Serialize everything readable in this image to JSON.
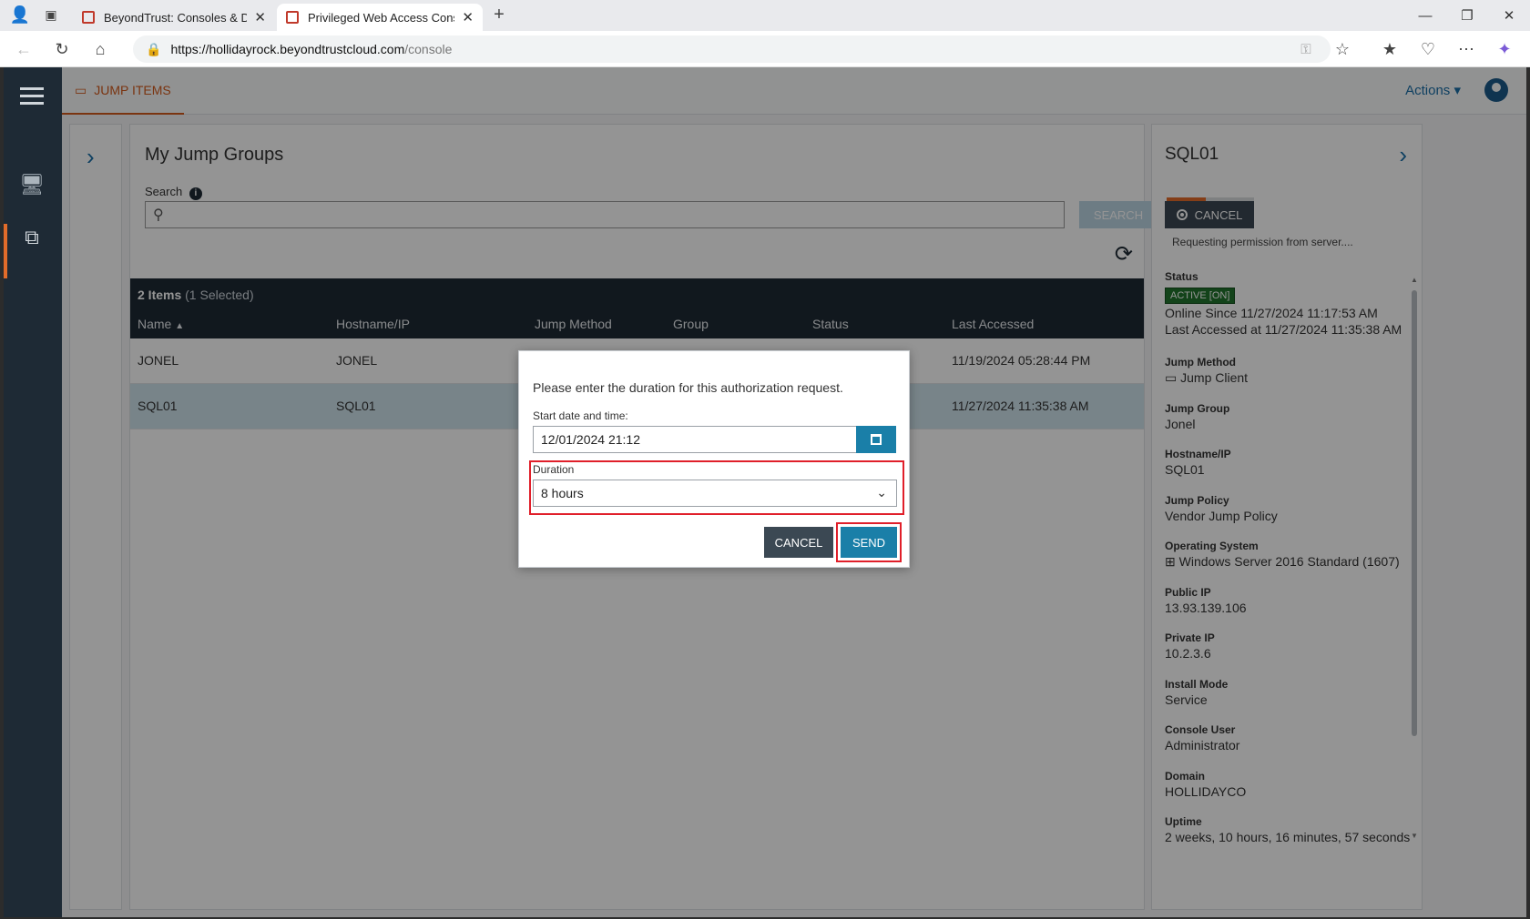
{
  "browser": {
    "tabs": [
      {
        "label": "BeyondTrust: Consoles & Downlo"
      },
      {
        "label": "Privileged Web Access Console - "
      }
    ],
    "url_host": "https://hollidayrock.beyondtrustcloud.com",
    "url_path": "/console"
  },
  "app": {
    "top_tab": "JUMP ITEMS",
    "actions_label": "Actions"
  },
  "main": {
    "title": "My Jump Groups",
    "search_label": "Search",
    "search_button": "SEARCH",
    "items_count": "2 Items",
    "selected_count": "(1 Selected)",
    "columns": [
      "Name",
      "Hostname/IP",
      "Jump Method",
      "Group",
      "Status",
      "Last Accessed"
    ],
    "rows": [
      {
        "name": "JONEL",
        "host": "JONEL",
        "last_accessed": "11/19/2024 05:28:44 PM"
      },
      {
        "name": "SQL01",
        "host": "SQL01",
        "last_accessed": "11/27/2024 11:35:38 AM"
      }
    ]
  },
  "detail": {
    "title": "SQL01",
    "cancel_label": "CANCEL",
    "requesting": "Requesting permission from server....",
    "status_label": "Status",
    "status_badge": "ACTIVE [ON]",
    "online_since": "Online Since 11/27/2024 11:17:53 AM",
    "last_accessed": "Last Accessed at 11/27/2024 11:35:38 AM",
    "fields": [
      {
        "label": "Jump Method",
        "value": "Jump Client"
      },
      {
        "label": "Jump Group",
        "value": "Jonel"
      },
      {
        "label": "Hostname/IP",
        "value": "SQL01"
      },
      {
        "label": "Jump Policy",
        "value": "Vendor Jump Policy"
      },
      {
        "label": "Operating System",
        "value": "Windows Server 2016 Standard (1607)"
      },
      {
        "label": "Public IP",
        "value": "13.93.139.106"
      },
      {
        "label": "Private IP",
        "value": "10.2.3.6"
      },
      {
        "label": "Install Mode",
        "value": "Service"
      },
      {
        "label": "Console User",
        "value": "Administrator"
      },
      {
        "label": "Domain",
        "value": "HOLLIDAYCO"
      },
      {
        "label": "Uptime",
        "value": "2 weeks, 10 hours, 16 minutes, 57 seconds"
      }
    ]
  },
  "modal": {
    "message": "Please enter the duration for this authorization request.",
    "start_label": "Start date and time:",
    "start_value": "12/01/2024 21:12",
    "duration_label": "Duration",
    "duration_value": "8 hours",
    "cancel_label": "CANCEL",
    "send_label": "SEND"
  },
  "colors": {
    "accent": "#1a7fa8",
    "nav_dark": "#1e2a35",
    "highlight": "#e01f2a",
    "active_badge": "#21742d",
    "tab_orange": "#d35b1c"
  }
}
